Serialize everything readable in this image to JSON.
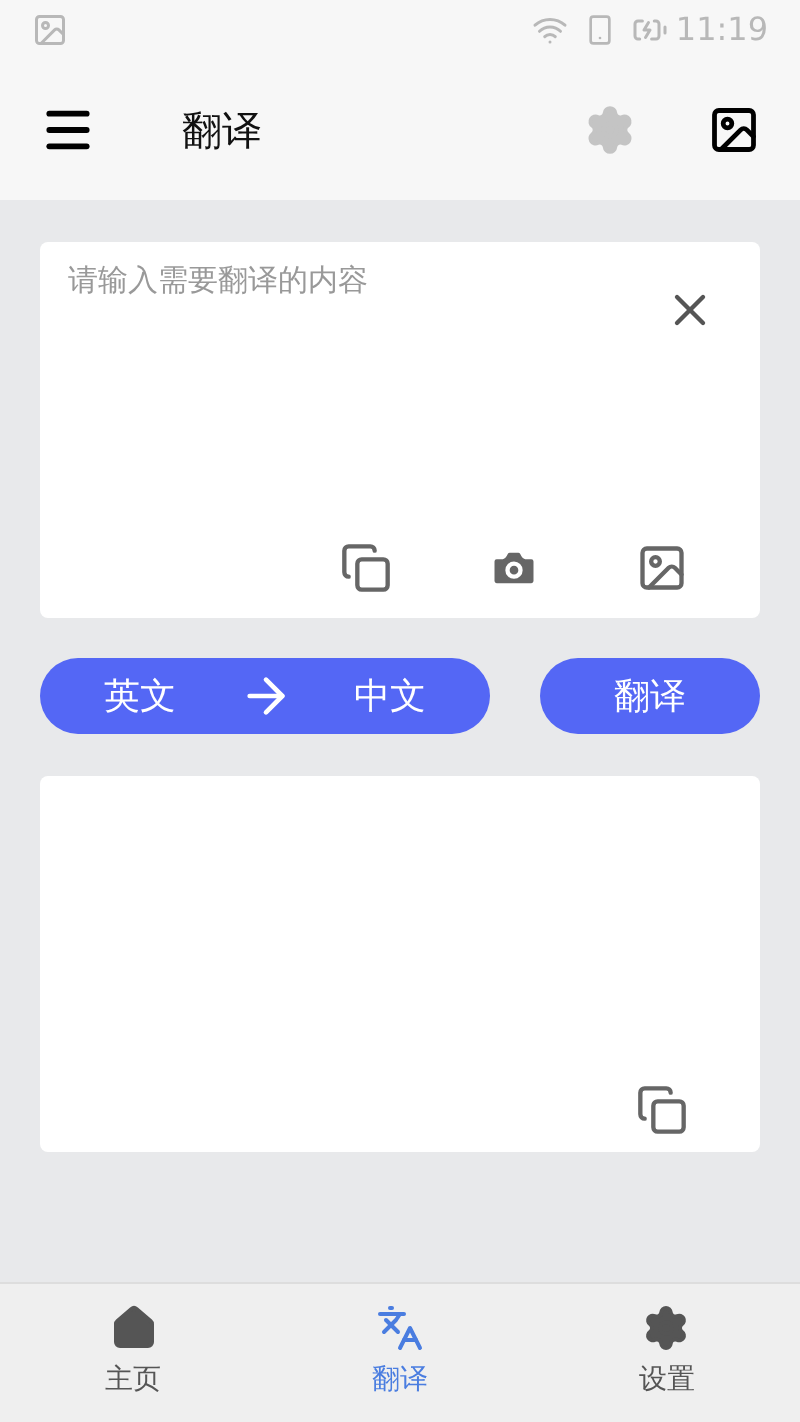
{
  "status_bar": {
    "time": "11:19"
  },
  "toolbar": {
    "title": "翻译"
  },
  "input": {
    "placeholder": "请输入需要翻译的内容"
  },
  "language_switch": {
    "source": "英文",
    "target": "中文"
  },
  "translate_button": {
    "label": "翻译"
  },
  "bottom_nav": [
    {
      "label": "主页",
      "kind": "home",
      "selected": false
    },
    {
      "label": "翻译",
      "kind": "translate",
      "selected": true
    },
    {
      "label": "设置",
      "kind": "settings",
      "selected": false
    }
  ]
}
